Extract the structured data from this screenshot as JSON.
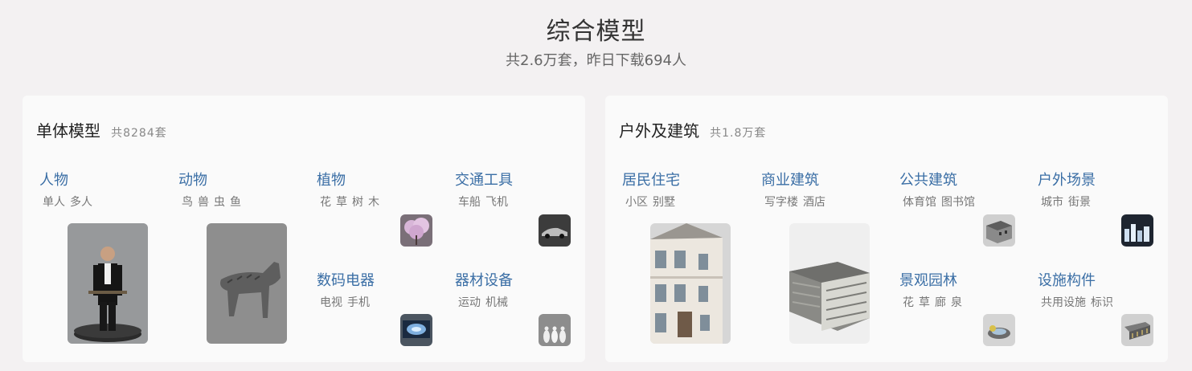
{
  "header": {
    "title": "综合模型",
    "subtitle": "共2.6万套，昨日下载694人"
  },
  "left_panel": {
    "title": "单体模型",
    "count": "共8284套",
    "categories": [
      {
        "label": "人物",
        "subs": [
          "单人",
          "多人"
        ]
      },
      {
        "label": "动物",
        "subs": [
          "鸟",
          "兽",
          "虫",
          "鱼"
        ]
      },
      {
        "label": "植物",
        "subs": [
          "花",
          "草",
          "树",
          "木"
        ]
      },
      {
        "label": "交通工具",
        "subs": [
          "车船",
          "飞机"
        ]
      },
      {
        "label": "数码电器",
        "subs": [
          "电视",
          "手机"
        ]
      },
      {
        "label": "器材设备",
        "subs": [
          "运动",
          "机械"
        ]
      }
    ]
  },
  "right_panel": {
    "title": "户外及建筑",
    "count": "共1.8万套",
    "categories": [
      {
        "label": "居民住宅",
        "subs": [
          "小区",
          "别墅"
        ]
      },
      {
        "label": "商业建筑",
        "subs": [
          "写字楼",
          "酒店"
        ]
      },
      {
        "label": "公共建筑",
        "subs": [
          "体育馆",
          "图书馆"
        ]
      },
      {
        "label": "户外场景",
        "subs": [
          "城市",
          "街景"
        ]
      },
      {
        "label": "景观园林",
        "subs": [
          "花",
          "草",
          "廊",
          "泉"
        ]
      },
      {
        "label": "设施构件",
        "subs": [
          "共用设施",
          "标识"
        ]
      }
    ]
  },
  "colors": {
    "background": "#f3f1f2",
    "panel": "#fafafa",
    "link": "#3a6ea5",
    "subtext": "#777777"
  }
}
